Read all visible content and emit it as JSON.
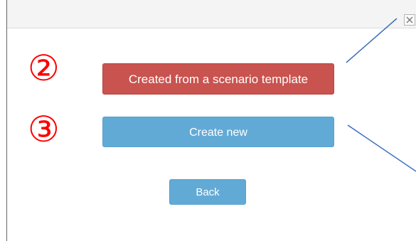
{
  "dialog": {
    "close_icon": "close-icon"
  },
  "markers": {
    "step_2": "②",
    "step_3": "③"
  },
  "buttons": {
    "template_label": "Created from a scenario template",
    "create_new_label": "Create new",
    "back_label": "Back"
  },
  "colors": {
    "template_button": "#c9534f",
    "primary_button": "#62aad6",
    "marker": "#ff0000",
    "callout_line": "#3f6fc0"
  }
}
